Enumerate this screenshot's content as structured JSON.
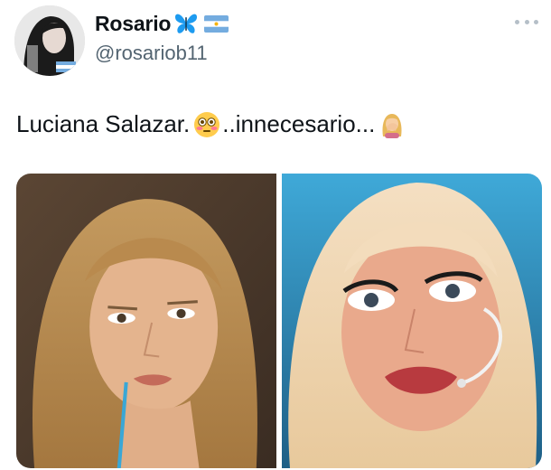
{
  "author": {
    "display_name": "Rosario",
    "handle": "@rosariob11",
    "name_icons": [
      "butterfly-icon",
      "argentina-flag-icon"
    ]
  },
  "tweet": {
    "text_part1": "Luciana Salazar.",
    "emoji1": "flushed-face-emoji",
    "text_part2": "..innecesario...",
    "emoji2": "woman-facepalming-emoji"
  },
  "media": {
    "count": 2,
    "images": [
      "before-photo",
      "after-photo"
    ]
  },
  "colors": {
    "text": "#0f1419",
    "secondary": "#536471",
    "butterfly": "#1d9bf0",
    "flag_blue": "#74acdf"
  },
  "menu": {
    "icon": "more-icon"
  }
}
